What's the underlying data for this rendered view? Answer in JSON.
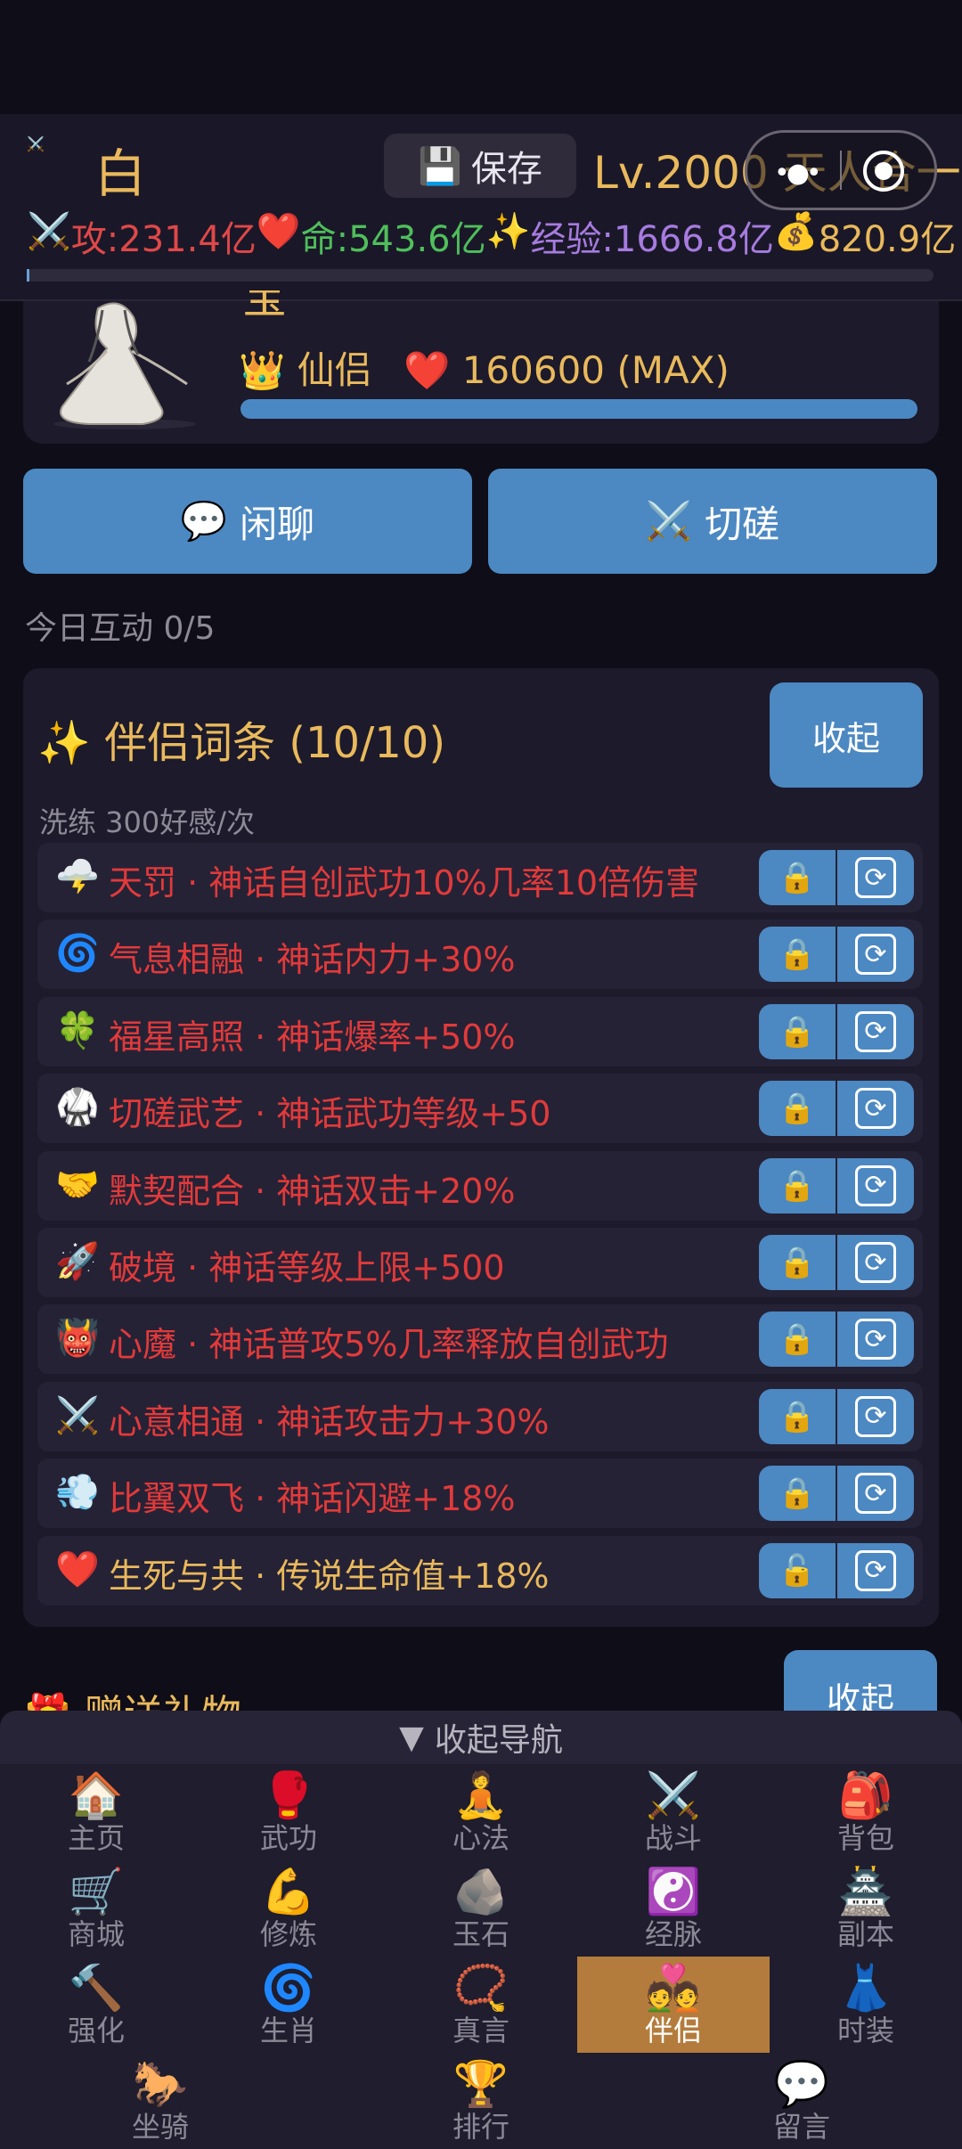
{
  "header": {
    "player_icon": "⚔️",
    "player_name": "白",
    "save_icon": "💾",
    "save_label": "保存",
    "level_text": "Lv.2000 天人合一",
    "stats": {
      "attack_icon": "⚔️",
      "attack": "攻:231.4亿",
      "hp_icon": "❤️",
      "hp": "命:543.6亿",
      "exp_icon": "✨",
      "exp": "经验:1666.8亿",
      "gold_icon": "💰",
      "gold": "820.9亿"
    }
  },
  "companion": {
    "name_partial": "宝",
    "title_icon": "👑",
    "title": "仙侣",
    "affection_icon": "❤️",
    "affection": "160600 (MAX)",
    "affection_progress": 1.0
  },
  "actions": {
    "chat_icon": "💬",
    "chat_label": "闲聊",
    "spar_icon": "⚔️",
    "spar_label": "切磋"
  },
  "daily_interaction": "今日互动 0/5",
  "traits_panel": {
    "title_icon": "✨",
    "title": "伴侣词条 (10/10)",
    "collapse_label": "收起",
    "refine_cost": "洗练 300好感/次",
    "traits": [
      {
        "icon": "🌩️",
        "text": "天罚 · 神话自创武功10%几率10倍伤害",
        "tier": "mythic",
        "lock": "🔒",
        "refresh": "🔄"
      },
      {
        "icon": "🌀",
        "text": "气息相融 · 神话内力+30%",
        "tier": "mythic",
        "lock": "🔒",
        "refresh": "🔄"
      },
      {
        "icon": "🍀",
        "text": "福星高照 · 神话爆率+50%",
        "tier": "mythic",
        "lock": "🔒",
        "refresh": "🔄"
      },
      {
        "icon": "🥋",
        "text": "切磋武艺 · 神话武功等级+50",
        "tier": "mythic",
        "lock": "🔒",
        "refresh": "🔄"
      },
      {
        "icon": "🤝",
        "text": "默契配合 · 神话双击+20%",
        "tier": "mythic",
        "lock": "🔒",
        "refresh": "🔄"
      },
      {
        "icon": "🚀",
        "text": "破境 · 神话等级上限+500",
        "tier": "mythic",
        "lock": "🔒",
        "refresh": "🔄"
      },
      {
        "icon": "👹",
        "text": "心魔 · 神话普攻5%几率释放自创武功",
        "tier": "mythic",
        "lock": "🔒",
        "refresh": "🔄"
      },
      {
        "icon": "⚔️",
        "text": "心意相通 · 神话攻击力+30%",
        "tier": "mythic",
        "lock": "🔒",
        "refresh": "🔄"
      },
      {
        "icon": "💨",
        "text": "比翼双飞 · 神话闪避+18%",
        "tier": "mythic",
        "lock": "🔒",
        "refresh": "🔄"
      },
      {
        "icon": "❤️",
        "text": "生死与共 · 传说生命值+18%",
        "tier": "legend",
        "lock": "🔓",
        "refresh": "🔄"
      }
    ]
  },
  "gift_section": {
    "icon": "🎁",
    "title": "赠送礼物",
    "collapse_label": "收起"
  },
  "nav": {
    "toggle_icon": "▼",
    "toggle_label": "收起导航",
    "items": [
      {
        "icon": "🏠",
        "label": "主页"
      },
      {
        "icon": "🥊",
        "label": "武功"
      },
      {
        "icon": "🧘",
        "label": "心法"
      },
      {
        "icon": "⚔️",
        "label": "战斗"
      },
      {
        "icon": "🎒",
        "label": "背包"
      },
      {
        "icon": "🛒",
        "label": "商城"
      },
      {
        "icon": "💪",
        "label": "修炼"
      },
      {
        "icon": "🪨",
        "label": "玉石"
      },
      {
        "icon": "☯️",
        "label": "经脉"
      },
      {
        "icon": "🏯",
        "label": "副本"
      },
      {
        "icon": "🔨",
        "label": "强化"
      },
      {
        "icon": "🌀",
        "label": "生肖"
      },
      {
        "icon": "📿",
        "label": "真言"
      },
      {
        "icon": "💑",
        "label": "伴侣",
        "active": true
      },
      {
        "icon": "👗",
        "label": "时装"
      },
      {
        "icon": "🐎",
        "label": "坐骑"
      },
      {
        "icon": "🏆",
        "label": "排行"
      },
      {
        "icon": "💬",
        "label": "留言"
      }
    ]
  }
}
